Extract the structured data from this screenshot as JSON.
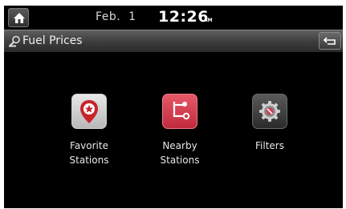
{
  "status_bar": {
    "date": "Feb.  1",
    "time": "12:26",
    "ampm": "AM"
  },
  "title_bar": {
    "title": "Fuel Prices"
  },
  "menu": [
    {
      "label": "Favorite\nStations",
      "icon": "favorite-location-icon"
    },
    {
      "label": "Nearby\nStations",
      "icon": "nearby-route-icon"
    },
    {
      "label": "Filters",
      "icon": "filter-gear-icon"
    }
  ],
  "colors": {
    "screen_background": "#000000",
    "title_bar": "#4a4a4a",
    "favorite_icon": "#c8242c",
    "nearby_icon": "#d43c50",
    "filter_icon": "#3a3a3a"
  }
}
